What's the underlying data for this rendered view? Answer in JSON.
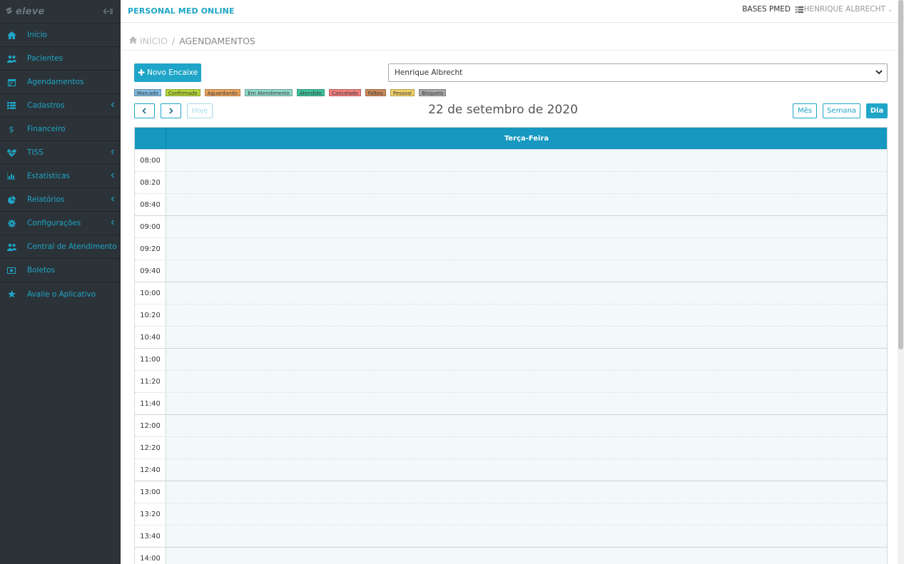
{
  "sidebar": {
    "logo": "eleve",
    "items": [
      {
        "label": "Início",
        "icon": "home-icon",
        "caret": false
      },
      {
        "label": "Pacientes",
        "icon": "users-icon",
        "caret": false
      },
      {
        "label": "Agendamentos",
        "icon": "calendar-icon",
        "caret": false
      },
      {
        "label": "Cadastros",
        "icon": "list-icon",
        "caret": true
      },
      {
        "label": "Financeiro",
        "icon": "dollar-icon",
        "caret": false
      },
      {
        "label": "TISS",
        "icon": "heartbeat-icon",
        "caret": true
      },
      {
        "label": "Estatísticas",
        "icon": "bar-chart-icon",
        "caret": true
      },
      {
        "label": "Relatórios",
        "icon": "pie-chart-icon",
        "caret": true
      },
      {
        "label": "Configurações",
        "icon": "gear-icon",
        "caret": true
      },
      {
        "label": "Central de Atendimento",
        "icon": "users-icon",
        "caret": false
      },
      {
        "label": "Boletos",
        "icon": "money-icon",
        "caret": false
      },
      {
        "label": "Avalie o Aplicativo",
        "icon": "star-icon",
        "caret": false
      }
    ]
  },
  "header": {
    "app_title": "PERSONAL MED ONLINE",
    "bases_label": "BASES PMED",
    "user_name": "HENRIQUE ALBRECHT"
  },
  "breadcrumb": {
    "home": "INÍCIO",
    "separator": "/",
    "current": "AGENDAMENTOS"
  },
  "toolbar": {
    "new_button": "Novo Encaixe",
    "professional_selected": "Henrique Albrecht"
  },
  "legend": [
    {
      "label": "Marcado",
      "color": "#7fb9df"
    },
    {
      "label": "Confirmado",
      "color": "#b5d63a"
    },
    {
      "label": "Aguardando",
      "color": "#eaa45e"
    },
    {
      "label": "Em Atendimento",
      "color": "#8fd8c8"
    },
    {
      "label": "Atendido",
      "color": "#3fc39c"
    },
    {
      "label": "Cancelado",
      "color": "#f08080"
    },
    {
      "label": "Faltou",
      "color": "#cc8a5a"
    },
    {
      "label": "Pessoal",
      "color": "#f1d168"
    },
    {
      "label": "Bloqueio",
      "color": "#a8a8a8"
    }
  ],
  "calendar": {
    "today_button": "Hoje",
    "date_title": "22 de setembro de 2020",
    "view_month": "Mês",
    "view_week": "Semana",
    "view_day": "Dia",
    "day_header": "Terça-Feira",
    "times": [
      "08:00",
      "08:20",
      "08:40",
      "09:00",
      "09:20",
      "09:40",
      "10:00",
      "10:20",
      "10:40",
      "11:00",
      "11:20",
      "11:40",
      "12:00",
      "12:20",
      "12:40",
      "13:00",
      "13:20",
      "13:40",
      "14:00"
    ]
  },
  "colors": {
    "accent": "#1ea5c7",
    "sidebar_bg": "#2c3338",
    "calendar_header": "#1698c0",
    "slot_bg": "#f2f9fb"
  }
}
